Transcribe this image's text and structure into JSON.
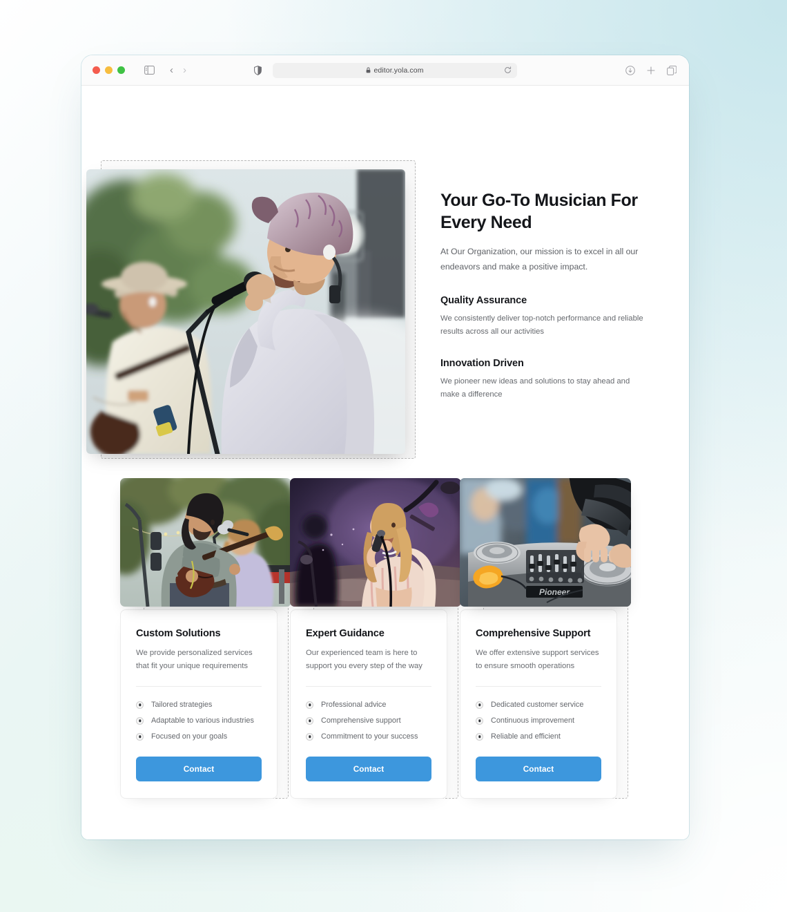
{
  "browser": {
    "traffic_lights": [
      "close",
      "minimize",
      "maximize"
    ],
    "sidebar_icon": "sidebar-icon",
    "back_label": "‹",
    "forward_label": "›",
    "shield_icon": "shield-icon",
    "lock_icon": "lock-icon",
    "url": "editor.yola.com",
    "reload_icon": "reload-icon",
    "download_icon": "download-icon",
    "new_tab_icon": "plus-icon",
    "tab_overview_icon": "tabs-icon"
  },
  "hero": {
    "image_alt": "two-musicians-performing-outdoors",
    "title": "Your Go-To Musician For Every Need",
    "subtitle": "At Our Organization, our mission is to excel in all our endeavors and make a positive impact.",
    "features": [
      {
        "title": "Quality Assurance",
        "body": "We consistently deliver top-notch performance and reliable results across all our activities"
      },
      {
        "title": "Innovation Driven",
        "body": "We pioneer new ideas and solutions to stay ahead and make a difference"
      }
    ]
  },
  "cards": [
    {
      "image_alt": "bassist-singing-at-outdoor-gig",
      "title": "Custom Solutions",
      "description": "We provide personalized services that fit your unique requirements",
      "bullets": [
        "Tailored strategies",
        "Adaptable to various industries",
        "Focused on your goals"
      ],
      "button": "Contact"
    },
    {
      "image_alt": "female-vocalist-on-lit-stage",
      "title": "Expert Guidance",
      "description": "Our experienced team is here to support you every step of the way",
      "bullets": [
        "Professional advice",
        "Comprehensive support",
        "Commitment to your success"
      ],
      "button": "Contact"
    },
    {
      "image_alt": "dj-hands-on-pioneer-mixer",
      "title": "Comprehensive Support",
      "description": "We offer extensive support services to ensure smooth operations",
      "bullets": [
        "Dedicated customer service",
        "Continuous improvement",
        "Reliable and efficient"
      ],
      "button": "Contact"
    }
  ],
  "colors": {
    "accent": "#3d97dd",
    "heading": "#14161a",
    "body_text": "#66696e",
    "selection_dash": "#bcbcbc",
    "page_bg_cyan": "#c7e6ec",
    "page_bg_mint": "#eaf7f2"
  }
}
